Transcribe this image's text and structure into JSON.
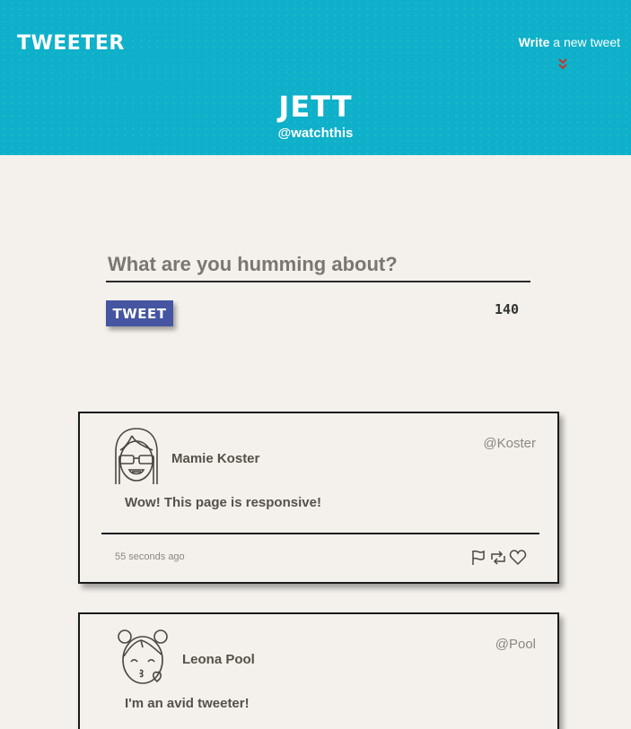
{
  "header": {
    "brand": "TWEETER",
    "write_bold": "Write",
    "write_rest": " a new tweet",
    "profile_name": "JETT",
    "profile_handle": "@watchthis"
  },
  "composer": {
    "placeholder": "What are you humming about?",
    "button_label": "TWEET",
    "char_count": "140"
  },
  "tweets": [
    {
      "author": "Mamie Koster",
      "handle": "@Koster",
      "text": "Wow! This page is responsive!",
      "time": "55 seconds ago",
      "avatar_icon": "girl-with-glasses-avatar"
    },
    {
      "author": "Leona Pool",
      "handle": "@Pool",
      "text": "I'm an avid tweeter!",
      "avatar_icon": "girl-blowing-kiss-avatar"
    }
  ],
  "icons": [
    "flag-icon",
    "retweet-icon",
    "heart-icon",
    "chevron-down-icon"
  ],
  "colors": {
    "header_bg": "#0fb0c9",
    "button_bg": "#4655a1",
    "page_bg": "#f4f1ec",
    "chevron": "#c0392b"
  }
}
